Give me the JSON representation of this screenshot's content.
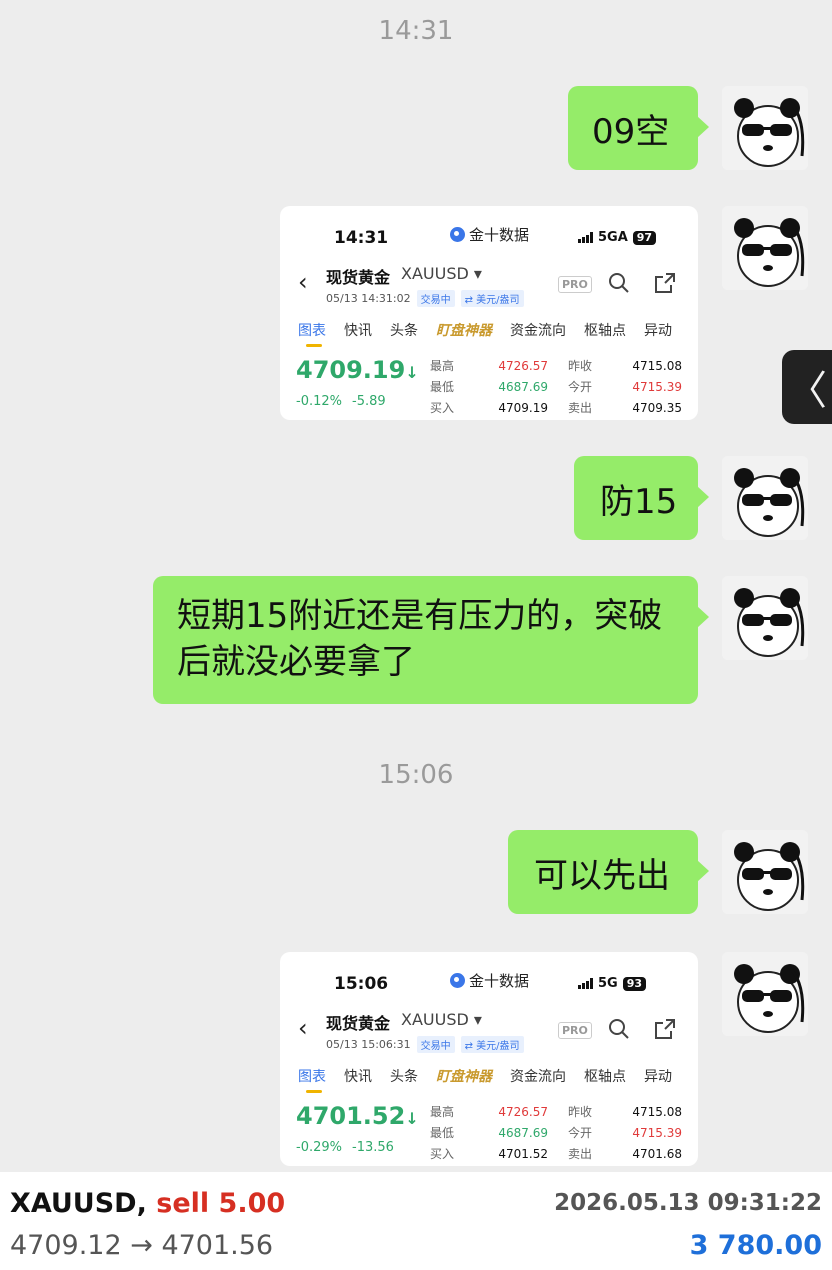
{
  "timestamps": [
    "14:31",
    "15:06"
  ],
  "messages": {
    "m1": "09空",
    "m2": "防15",
    "m3": "短期15附近还是有压力的，突破后就没必要拿了",
    "m4": "可以先出"
  },
  "quote_cards": [
    {
      "status_time": "14:31",
      "app_name": "金十数据",
      "network": "5GA",
      "battery": "97",
      "title": "现货黄金",
      "symbol": "XAUUSD",
      "datetime": "05/13 14:31:02",
      "trade_status": "交易中",
      "currency": "⇄ 美元/盎司",
      "pro_label": "PRO",
      "tabs": [
        "图表",
        "快讯",
        "头条",
        "盯盘神器",
        "资金流向",
        "枢轴点",
        "异动"
      ],
      "price": "4709.19",
      "change_pct": "-0.12%",
      "change_abs": "-5.89",
      "high_label": "最高",
      "high": "4726.57",
      "low_label": "最低",
      "low": "4687.69",
      "bid_label": "买入",
      "bid": "4709.19",
      "prev_close_label": "昨收",
      "prev_close": "4715.08",
      "open_label": "今开",
      "open": "4715.39",
      "ask_label": "卖出",
      "ask": "4709.35"
    },
    {
      "status_time": "15:06",
      "app_name": "金十数据",
      "network": "5G",
      "battery": "93",
      "title": "现货黄金",
      "symbol": "XAUUSD",
      "datetime": "05/13 15:06:31",
      "trade_status": "交易中",
      "currency": "⇄ 美元/盎司",
      "pro_label": "PRO",
      "tabs": [
        "图表",
        "快讯",
        "头条",
        "盯盘神器",
        "资金流向",
        "枢轴点",
        "异动"
      ],
      "price": "4701.52",
      "change_pct": "-0.29%",
      "change_abs": "-13.56",
      "high_label": "最高",
      "high": "4726.57",
      "low_label": "最低",
      "low": "4687.69",
      "bid_label": "买入",
      "bid": "4701.52",
      "prev_close_label": "昨收",
      "prev_close": "4715.08",
      "open_label": "今开",
      "open": "4715.39",
      "ask_label": "卖出",
      "ask": "4701.68"
    }
  ],
  "side_tab_glyph": "〈",
  "trade": {
    "symbol": "XAUUSD,",
    "side": "sell 5.00",
    "datetime": "2026.05.13 09:31:22",
    "prices": "4709.12 → 4701.56",
    "profit": "3 780.00"
  },
  "colors": {
    "bubble": "#95ec69",
    "background": "#ededed",
    "price_down": "#2fa86a",
    "price_up": "#e03a3a",
    "sell": "#d62f22",
    "profit": "#1e6fd9"
  },
  "icons": [
    "panda-avatar-icon",
    "back-chevron-icon",
    "search-icon",
    "share-icon",
    "signal-icon",
    "down-arrow-icon",
    "app-logo-icon"
  ]
}
